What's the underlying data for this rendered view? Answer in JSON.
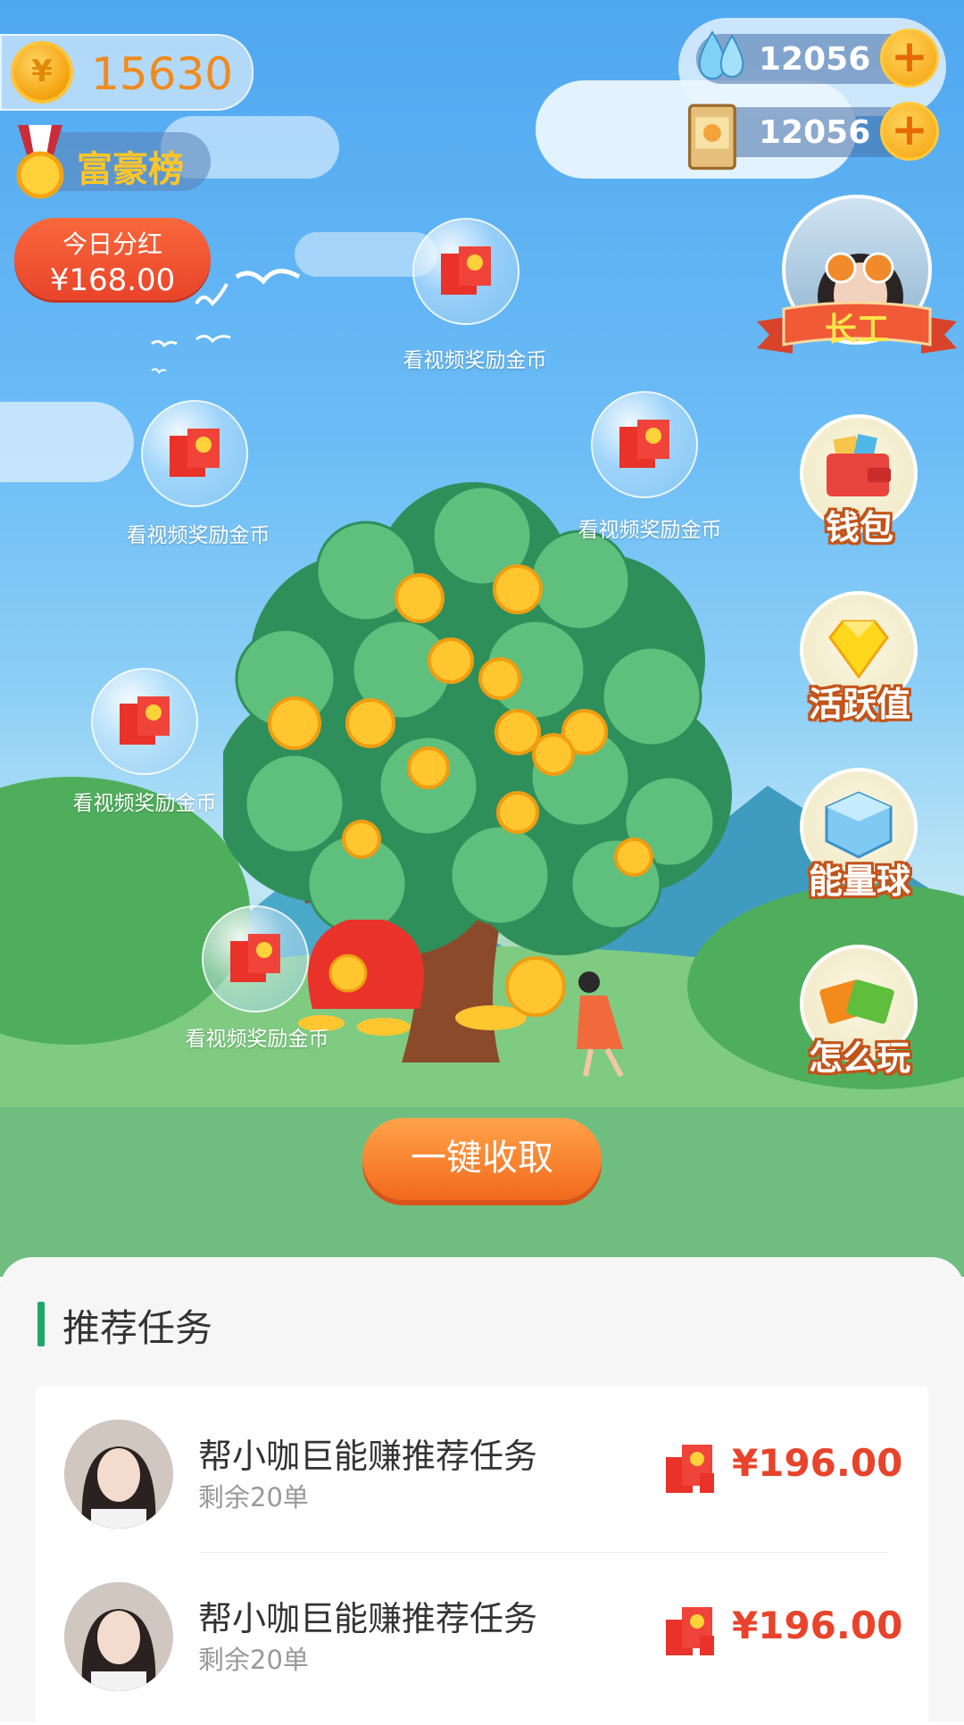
{
  "header": {
    "coins": "15630",
    "coin_symbol": "¥",
    "rich_list_label": "富豪榜",
    "dividend": {
      "label": "今日分红",
      "amount": "¥168.00"
    },
    "water_count": "12056",
    "seed_count": "12056",
    "plus_symbol": "+"
  },
  "worker": {
    "badge_label": "长工"
  },
  "side_menu": {
    "wallet": "钱包",
    "activity": "活跃值",
    "energy_ball": "能量球",
    "how_to_play": "怎么玩"
  },
  "bubbles": [
    {
      "label": "看视频奖励金币"
    },
    {
      "label": "看视频奖励金币"
    },
    {
      "label": "看视频奖励金币"
    },
    {
      "label": "看视频奖励金币"
    },
    {
      "label": "看视频奖励金币"
    }
  ],
  "collect_button": "一键收取",
  "tasks_section": {
    "title": "推荐任务",
    "items": [
      {
        "title": "帮小咖巨能赚推荐任务",
        "remaining": "剩余20单",
        "reward": "¥196.00"
      },
      {
        "title": "帮小咖巨能赚推荐任务",
        "remaining": "剩余20单",
        "reward": "¥196.00"
      }
    ]
  },
  "colors": {
    "accent_orange": "#f2691c",
    "reward_red": "#e8432b",
    "section_green": "#21a86a"
  },
  "icons": [
    "coin-icon",
    "medal-icon",
    "water-drop-icon",
    "seed-bag-icon",
    "plus-icon",
    "wallet-icon",
    "diamond-icon",
    "ice-cube-icon",
    "book-icon",
    "red-envelope-icon"
  ]
}
